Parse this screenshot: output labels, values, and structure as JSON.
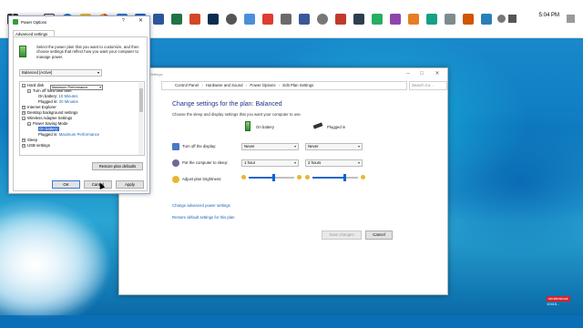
{
  "taskbar": {
    "time": "5:04 PM",
    "icons": [
      "start-icon",
      "search-icon",
      "task-view-icon",
      "edge-icon",
      "file-explorer-icon",
      "chrome-icon",
      "store-icon",
      "mail-icon",
      "word-icon",
      "excel-icon",
      "powerpoint-icon",
      "photoshop-icon",
      "settings-icon",
      "other-app-icon",
      "other-app-icon",
      "other-app-icon",
      "other-app-icon",
      "other-app-icon",
      "other-app-icon",
      "other-app-icon",
      "other-app-icon",
      "other-app-icon",
      "other-app-icon",
      "other-app-icon",
      "other-app-icon",
      "other-app-icon",
      "other-app-icon"
    ]
  },
  "control_panel": {
    "title": "Settings",
    "breadcrumb": [
      "Control Panel",
      "Hardware and Sound",
      "Power Options",
      "Edit Plan Settings"
    ],
    "search_placeholder": "Search Co...",
    "heading": "Change settings for the plan: Balanced",
    "subheading": "Choose the sleep and display settings that you want your computer to use.",
    "columns": {
      "on_battery": "On battery",
      "plugged_in": "Plugged in"
    },
    "settings": {
      "display": {
        "label": "Turn off the display:",
        "battery": "Never",
        "plugged": "Never"
      },
      "sleep": {
        "label": "Put the computer to sleep:",
        "battery": "1 hour",
        "plugged": "2 hours"
      },
      "brightness": {
        "label": "Adjust plan brightness:",
        "battery_level": 0.55,
        "plugged_level": 0.7
      }
    },
    "links": {
      "advanced": "Change advanced power settings",
      "restore": "Restore default settings for this plan"
    },
    "buttons": {
      "save": "Save changes",
      "cancel": "Cancel"
    }
  },
  "power_options": {
    "title": "Power Options",
    "help": "?",
    "close": "✕",
    "tab": "Advanced settings",
    "description": "Select the power plan that you want to customize, and then choose settings that reflect how you want your computer to manage power.",
    "plan": "Balanced [Active]",
    "tree": {
      "hard_disk": "Hard disk",
      "turn_off_hard_disk": "Turn off hard disk after",
      "on_battery_label": "On battery:",
      "on_battery_value": "10 Minutes",
      "plugged_in_label": "Plugged in:",
      "plugged_in_value": "20 Minutes",
      "internet_explorer": "Internet Explorer",
      "desktop_background": "Desktop background settings",
      "wireless_adapter": "Wireless Adapter Settings",
      "power_saving_mode": "Power Saving Mode",
      "ps_on_battery_label": "On battery:",
      "ps_on_battery_value": "Maximum Performance",
      "ps_plugged_in_label": "Plugged in:",
      "ps_plugged_in_value": "Maximum Performance",
      "sleep": "Sleep",
      "usb_settings": "USB settings"
    },
    "buttons": {
      "restore": "Restore plan defaults",
      "ok": "OK",
      "cancel": "Cancel",
      "apply": "Apply"
    }
  },
  "watermark": {
    "brand": "shutterstock",
    "id": "10415..."
  }
}
